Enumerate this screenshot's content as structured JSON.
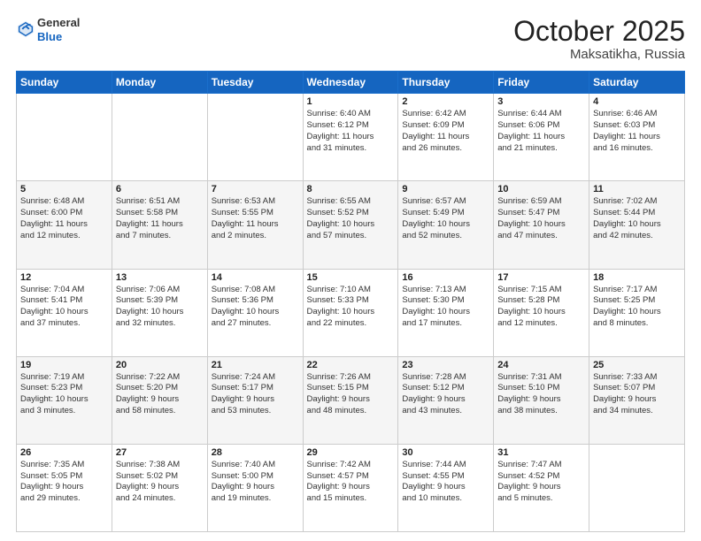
{
  "header": {
    "logo_general": "General",
    "logo_blue": "Blue",
    "month": "October 2025",
    "location": "Maksatikha, Russia"
  },
  "weekdays": [
    "Sunday",
    "Monday",
    "Tuesday",
    "Wednesday",
    "Thursday",
    "Friday",
    "Saturday"
  ],
  "weeks": [
    [
      {
        "day": "",
        "info": ""
      },
      {
        "day": "",
        "info": ""
      },
      {
        "day": "",
        "info": ""
      },
      {
        "day": "1",
        "info": "Sunrise: 6:40 AM\nSunset: 6:12 PM\nDaylight: 11 hours\nand 31 minutes."
      },
      {
        "day": "2",
        "info": "Sunrise: 6:42 AM\nSunset: 6:09 PM\nDaylight: 11 hours\nand 26 minutes."
      },
      {
        "day": "3",
        "info": "Sunrise: 6:44 AM\nSunset: 6:06 PM\nDaylight: 11 hours\nand 21 minutes."
      },
      {
        "day": "4",
        "info": "Sunrise: 6:46 AM\nSunset: 6:03 PM\nDaylight: 11 hours\nand 16 minutes."
      }
    ],
    [
      {
        "day": "5",
        "info": "Sunrise: 6:48 AM\nSunset: 6:00 PM\nDaylight: 11 hours\nand 12 minutes."
      },
      {
        "day": "6",
        "info": "Sunrise: 6:51 AM\nSunset: 5:58 PM\nDaylight: 11 hours\nand 7 minutes."
      },
      {
        "day": "7",
        "info": "Sunrise: 6:53 AM\nSunset: 5:55 PM\nDaylight: 11 hours\nand 2 minutes."
      },
      {
        "day": "8",
        "info": "Sunrise: 6:55 AM\nSunset: 5:52 PM\nDaylight: 10 hours\nand 57 minutes."
      },
      {
        "day": "9",
        "info": "Sunrise: 6:57 AM\nSunset: 5:49 PM\nDaylight: 10 hours\nand 52 minutes."
      },
      {
        "day": "10",
        "info": "Sunrise: 6:59 AM\nSunset: 5:47 PM\nDaylight: 10 hours\nand 47 minutes."
      },
      {
        "day": "11",
        "info": "Sunrise: 7:02 AM\nSunset: 5:44 PM\nDaylight: 10 hours\nand 42 minutes."
      }
    ],
    [
      {
        "day": "12",
        "info": "Sunrise: 7:04 AM\nSunset: 5:41 PM\nDaylight: 10 hours\nand 37 minutes."
      },
      {
        "day": "13",
        "info": "Sunrise: 7:06 AM\nSunset: 5:39 PM\nDaylight: 10 hours\nand 32 minutes."
      },
      {
        "day": "14",
        "info": "Sunrise: 7:08 AM\nSunset: 5:36 PM\nDaylight: 10 hours\nand 27 minutes."
      },
      {
        "day": "15",
        "info": "Sunrise: 7:10 AM\nSunset: 5:33 PM\nDaylight: 10 hours\nand 22 minutes."
      },
      {
        "day": "16",
        "info": "Sunrise: 7:13 AM\nSunset: 5:30 PM\nDaylight: 10 hours\nand 17 minutes."
      },
      {
        "day": "17",
        "info": "Sunrise: 7:15 AM\nSunset: 5:28 PM\nDaylight: 10 hours\nand 12 minutes."
      },
      {
        "day": "18",
        "info": "Sunrise: 7:17 AM\nSunset: 5:25 PM\nDaylight: 10 hours\nand 8 minutes."
      }
    ],
    [
      {
        "day": "19",
        "info": "Sunrise: 7:19 AM\nSunset: 5:23 PM\nDaylight: 10 hours\nand 3 minutes."
      },
      {
        "day": "20",
        "info": "Sunrise: 7:22 AM\nSunset: 5:20 PM\nDaylight: 9 hours\nand 58 minutes."
      },
      {
        "day": "21",
        "info": "Sunrise: 7:24 AM\nSunset: 5:17 PM\nDaylight: 9 hours\nand 53 minutes."
      },
      {
        "day": "22",
        "info": "Sunrise: 7:26 AM\nSunset: 5:15 PM\nDaylight: 9 hours\nand 48 minutes."
      },
      {
        "day": "23",
        "info": "Sunrise: 7:28 AM\nSunset: 5:12 PM\nDaylight: 9 hours\nand 43 minutes."
      },
      {
        "day": "24",
        "info": "Sunrise: 7:31 AM\nSunset: 5:10 PM\nDaylight: 9 hours\nand 38 minutes."
      },
      {
        "day": "25",
        "info": "Sunrise: 7:33 AM\nSunset: 5:07 PM\nDaylight: 9 hours\nand 34 minutes."
      }
    ],
    [
      {
        "day": "26",
        "info": "Sunrise: 7:35 AM\nSunset: 5:05 PM\nDaylight: 9 hours\nand 29 minutes."
      },
      {
        "day": "27",
        "info": "Sunrise: 7:38 AM\nSunset: 5:02 PM\nDaylight: 9 hours\nand 24 minutes."
      },
      {
        "day": "28",
        "info": "Sunrise: 7:40 AM\nSunset: 5:00 PM\nDaylight: 9 hours\nand 19 minutes."
      },
      {
        "day": "29",
        "info": "Sunrise: 7:42 AM\nSunset: 4:57 PM\nDaylight: 9 hours\nand 15 minutes."
      },
      {
        "day": "30",
        "info": "Sunrise: 7:44 AM\nSunset: 4:55 PM\nDaylight: 9 hours\nand 10 minutes."
      },
      {
        "day": "31",
        "info": "Sunrise: 7:47 AM\nSunset: 4:52 PM\nDaylight: 9 hours\nand 5 minutes."
      },
      {
        "day": "",
        "info": ""
      }
    ]
  ]
}
